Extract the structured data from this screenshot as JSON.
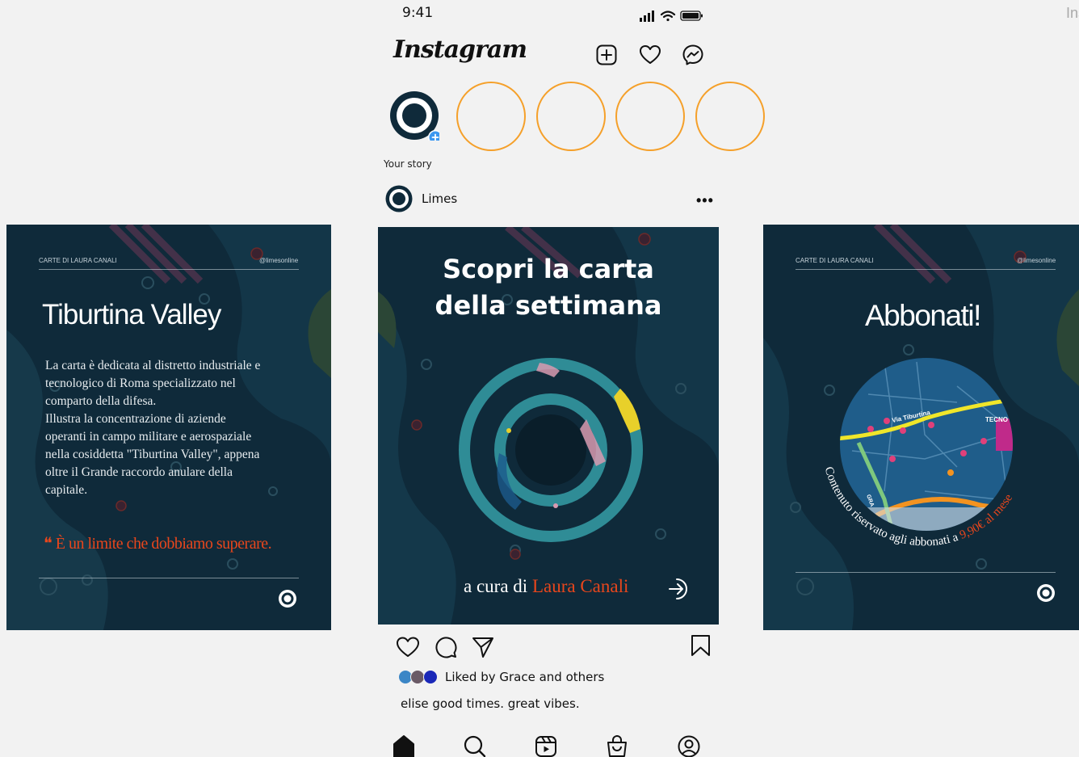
{
  "status_bar": {
    "time": "9:41",
    "icons": [
      "signal-icon",
      "wifi-icon",
      "battery-icon"
    ]
  },
  "corner_text": "Ins",
  "header": {
    "logo": "Instagram",
    "icons": [
      "add-post-icon",
      "heart-icon",
      "messenger-icon"
    ]
  },
  "stories": {
    "your_story_label": "Your story",
    "ring_color": "#f5a02a"
  },
  "post": {
    "username": "Limes",
    "more_label": "•••",
    "likes_text": "Liked by Grace and others",
    "caption": "elise good times. great vibes."
  },
  "left_card": {
    "top_left": "CARTE DI LAURA CANALI",
    "top_right": "@limesonline",
    "title": "Tiburtina Valley",
    "body": "La carta è dedicata al distretto industriale e\ntecnologico di Roma specializzato nel\ncomparto della difesa.\nIllustra la concentrazione di aziende\noperanti in campo militare e aerospaziale\nnella cosiddetta \"Tiburtina Valley\", appena\noltre il Grande raccordo anulare della\ncapitale.",
    "quote": "❝ È un limite che dobbiamo superare."
  },
  "center_card": {
    "title": "Scopri la carta\ndella settimana",
    "credit_prefix": "a cura di ",
    "credit_name": "Laura Canali"
  },
  "right_card": {
    "top_left": "CARTE DI LAURA CANALI",
    "top_right": "@limesonline",
    "title": "Abbonati!",
    "arc_text": "Contenuto riservato agli abbonati a ",
    "arc_price": "9,90€ al mese",
    "map_labels": {
      "road": "Via Tiburtina",
      "area": "TECNO",
      "gra": "GRA"
    }
  },
  "colors": {
    "accent": "#e8461c",
    "card_bg": "#0f2a3a",
    "teal": "#2f8c96",
    "story_ring": "#f5a02a"
  },
  "bottom_nav": [
    "home-icon",
    "search-icon",
    "reels-icon",
    "shop-icon",
    "profile-icon"
  ]
}
